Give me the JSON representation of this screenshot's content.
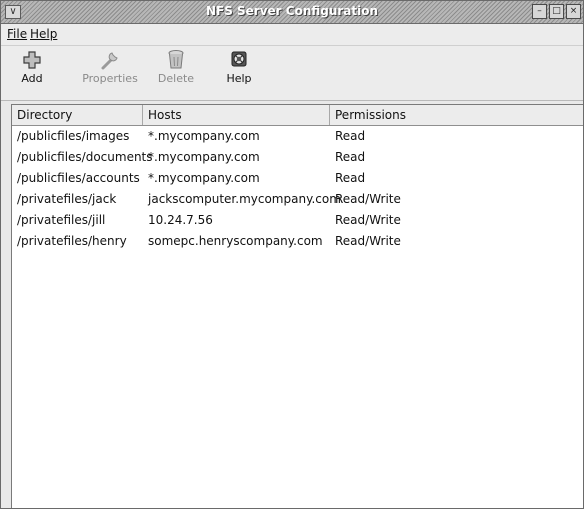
{
  "window": {
    "title": "NFS Server Configuration",
    "menu_button": "∨",
    "controls": {
      "minimize": "–",
      "maximize": "□",
      "close": "×"
    }
  },
  "menu": {
    "file": "File",
    "help": "Help"
  },
  "toolbar": {
    "add": {
      "label": "Add",
      "icon": "add-plus-icon",
      "enabled": true
    },
    "properties": {
      "label": "Properties",
      "icon": "wrench-icon",
      "enabled": false
    },
    "delete": {
      "label": "Delete",
      "icon": "trash-icon",
      "enabled": false
    },
    "help": {
      "label": "Help",
      "icon": "lifebuoy-icon",
      "enabled": true
    }
  },
  "table": {
    "columns": [
      "Directory",
      "Hosts",
      "Permissions"
    ],
    "rows": [
      {
        "directory": "/publicfiles/images",
        "hosts": "*.mycompany.com",
        "permissions": "Read"
      },
      {
        "directory": "/publicfiles/documents",
        "hosts": "*.mycompany.com",
        "permissions": "Read"
      },
      {
        "directory": "/publicfiles/accounts",
        "hosts": "*.mycompany.com",
        "permissions": "Read"
      },
      {
        "directory": "/privatefiles/jack",
        "hosts": "jackscomputer.mycompany.com",
        "permissions": "Read/Write"
      },
      {
        "directory": "/privatefiles/jill",
        "hosts": "10.24.7.56",
        "permissions": "Read/Write"
      },
      {
        "directory": "/privatefiles/henry",
        "hosts": "somepc.henryscompany.com",
        "permissions": "Read/Write"
      }
    ]
  }
}
